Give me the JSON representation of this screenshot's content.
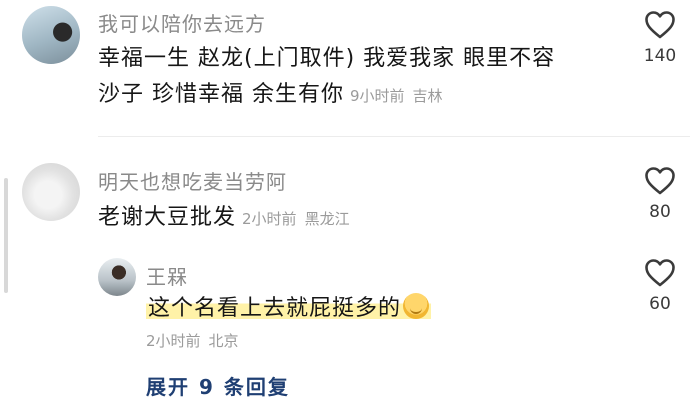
{
  "comments": [
    {
      "name": "我可以陪你去远方",
      "text_line1": "幸福一生 赵龙(上门取件) 我爱我家 眼里不容",
      "text_line2": "沙子 珍惜幸福 余生有你",
      "time": "9小时前",
      "location": "吉林",
      "likes": "140"
    },
    {
      "name": "明天也想吃麦当劳阿",
      "text": "老谢大豆批发",
      "time": "2小时前",
      "location": "黑龙江",
      "likes": "80"
    }
  ],
  "reply": {
    "name": "王槑",
    "text": "这个名看上去就屁挺多的",
    "time": "2小时前",
    "location": "北京",
    "likes": "60",
    "emoji_icon": "shy-face-emoji"
  },
  "expand_label": "展开 9 条回复",
  "colors": {
    "name_gray": "#8a8a8a",
    "text": "#161616",
    "meta": "#9b9b9b",
    "link_blue": "#1f3f73",
    "highlight": "#fff2a8"
  }
}
